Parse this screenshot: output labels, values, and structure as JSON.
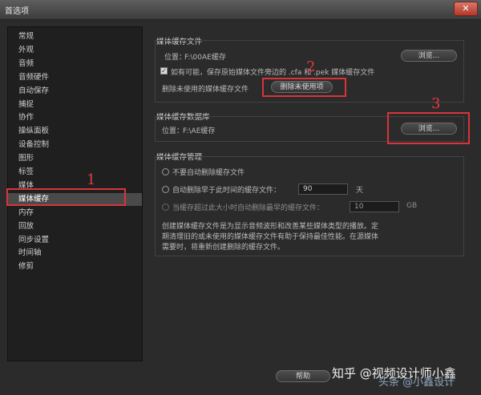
{
  "window": {
    "title": "首选项",
    "close_glyph": "✕"
  },
  "sidebar": {
    "items": [
      {
        "label": "常规"
      },
      {
        "label": "外观"
      },
      {
        "label": "音频"
      },
      {
        "label": "音频硬件"
      },
      {
        "label": "自动保存"
      },
      {
        "label": "捕捉"
      },
      {
        "label": "协作"
      },
      {
        "label": "操纵面板"
      },
      {
        "label": "设备控制"
      },
      {
        "label": "图形"
      },
      {
        "label": "标签"
      },
      {
        "label": "媒体"
      },
      {
        "label": "媒体缓存"
      },
      {
        "label": "内存"
      },
      {
        "label": "回放"
      },
      {
        "label": "同步设置"
      },
      {
        "label": "时间轴"
      },
      {
        "label": "修剪"
      }
    ],
    "selected_index": 12
  },
  "media_cache_files": {
    "group_label": "媒体缓存文件",
    "location_label": "位置：",
    "location_value": "F:\\00AE缓存",
    "browse_label": "浏览...",
    "checkbox_checked": true,
    "checkbox_label": "如有可能，保存原始媒体文件旁边的 .cfa 和 .pek 媒体缓存文件",
    "delete_unused_label": "删除未使用的媒体缓存文件",
    "delete_unused_button": "删除未使用项"
  },
  "media_cache_db": {
    "group_label": "媒体缓存数据库",
    "location_label": "位置：",
    "location_value": "F:\\AE缓存",
    "browse_label": "浏览..."
  },
  "media_cache_mgmt": {
    "group_label": "媒体缓存管理",
    "opt_none": "不要自动删除缓存文件",
    "opt_older": "自动删除早于此时间的缓存文件：",
    "opt_older_value": "90",
    "opt_older_unit": "天",
    "opt_size": "当缓存超过此大小时自动删除最早的缓存文件：",
    "opt_size_value": "10",
    "opt_size_unit": "GB",
    "description": [
      "创建媒体缓存文件是为显示音频波形和改善某些媒体类型的播放。定",
      "期清理旧的或未使用的媒体缓存文件有助于保持最佳性能。在源媒体",
      "需要时，将重新创建删除的缓存文件。"
    ]
  },
  "footer": {
    "help_label": "帮助"
  },
  "annotations": {
    "n1": "1",
    "n2": "2",
    "n3": "3"
  },
  "watermark": {
    "text": "知乎 @视频设计师小鑫",
    "overlay": "头条 @小鑫设计"
  },
  "colors": {
    "annotation_red": "#d8343a",
    "selected_bg": "#4a4a4a"
  }
}
